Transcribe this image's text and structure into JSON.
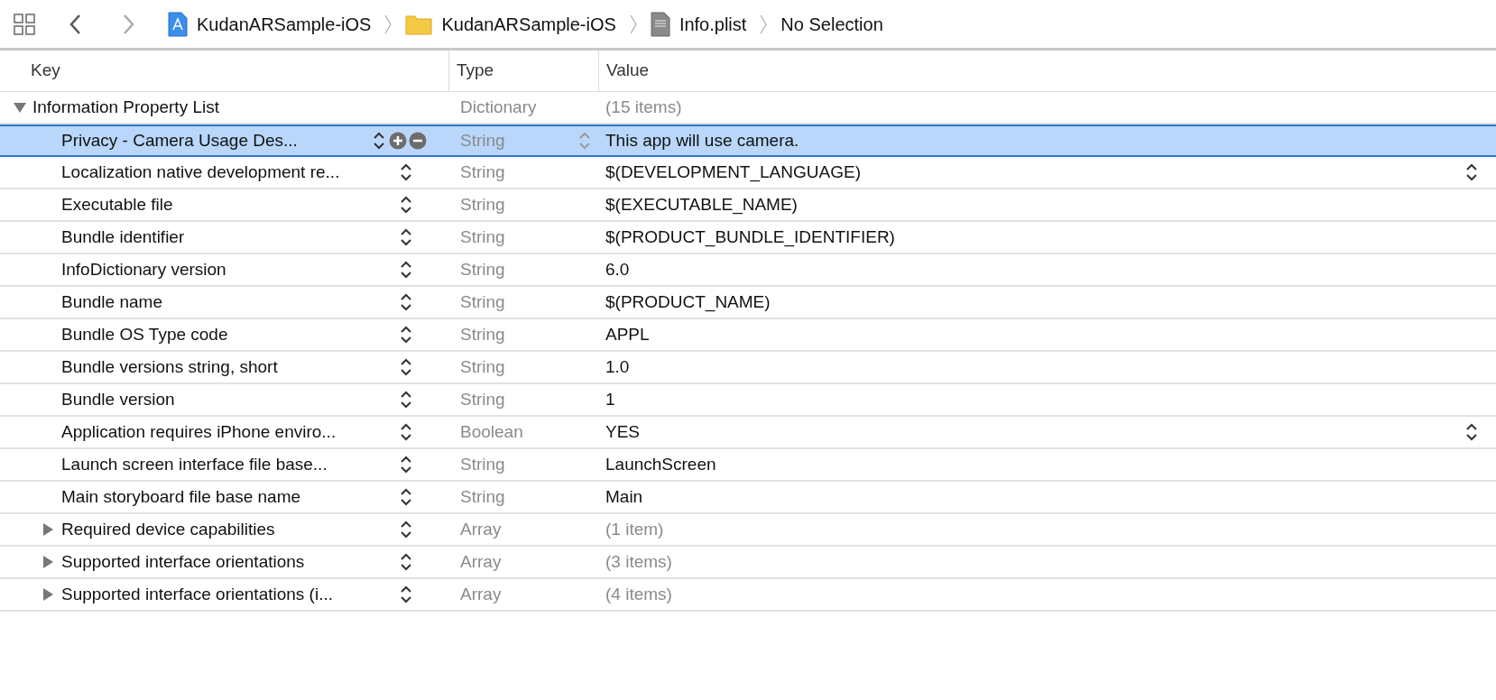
{
  "breadcrumb": [
    {
      "kind": "project",
      "label": "KudanARSample-iOS"
    },
    {
      "kind": "folder",
      "label": "KudanARSample-iOS"
    },
    {
      "kind": "file",
      "label": "Info.plist"
    },
    {
      "kind": "text",
      "label": "No Selection"
    }
  ],
  "table": {
    "columns": [
      "Key",
      "Type",
      "Value"
    ],
    "rows": [
      {
        "key": "Information Property List",
        "type": "Dictionary",
        "value": "(15 items)",
        "expanded": true,
        "selected": false,
        "children": [
          {
            "key": "Privacy - Camera Usage Des...",
            "type": "String",
            "value": "This app will use camera.",
            "selected": true
          },
          {
            "key": "Localization native development re...",
            "type": "String",
            "value": "$(DEVELOPMENT_LANGUAGE)",
            "selected": false,
            "value_popup": true
          },
          {
            "key": "Executable file",
            "type": "String",
            "value": "$(EXECUTABLE_NAME)",
            "selected": false
          },
          {
            "key": "Bundle identifier",
            "type": "String",
            "value": "$(PRODUCT_BUNDLE_IDENTIFIER)",
            "selected": false
          },
          {
            "key": "InfoDictionary version",
            "type": "String",
            "value": "6.0",
            "selected": false
          },
          {
            "key": "Bundle name",
            "type": "String",
            "value": "$(PRODUCT_NAME)",
            "selected": false
          },
          {
            "key": "Bundle OS Type code",
            "type": "String",
            "value": "APPL",
            "selected": false
          },
          {
            "key": "Bundle versions string, short",
            "type": "String",
            "value": "1.0",
            "selected": false
          },
          {
            "key": "Bundle version",
            "type": "String",
            "value": "1",
            "selected": false
          },
          {
            "key": "Application requires iPhone enviro...",
            "type": "Boolean",
            "value": "YES",
            "selected": false,
            "value_popup": true
          },
          {
            "key": "Launch screen interface file base...",
            "type": "String",
            "value": "LaunchScreen",
            "selected": false
          },
          {
            "key": "Main storyboard file base name",
            "type": "String",
            "value": "Main",
            "selected": false
          },
          {
            "key": "Required device capabilities",
            "type": "Array",
            "value": "(1 item)",
            "expanded": false,
            "selected": false
          },
          {
            "key": "Supported interface orientations",
            "type": "Array",
            "value": "(3 items)",
            "expanded": false,
            "selected": false
          },
          {
            "key": "Supported interface orientations (i...",
            "type": "Array",
            "value": "(4 items)",
            "expanded": false,
            "selected": false
          }
        ]
      }
    ]
  }
}
